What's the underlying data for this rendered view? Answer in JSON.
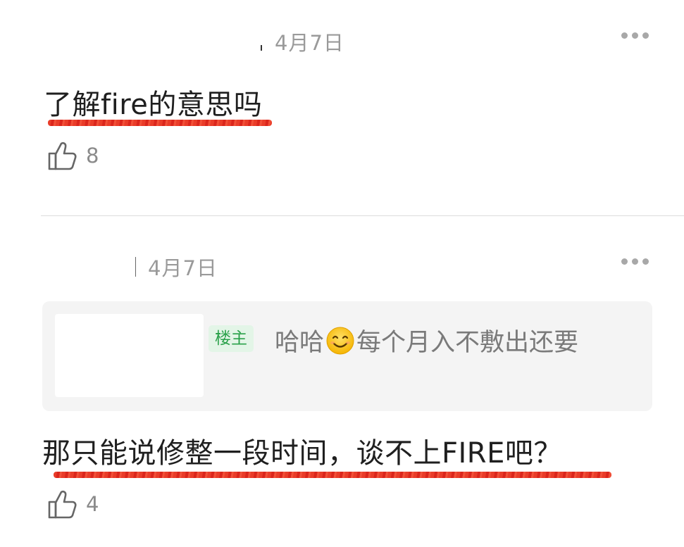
{
  "comments": [
    {
      "date": "4月7日",
      "text": "了解fire的意思吗",
      "like_count": "8"
    },
    {
      "date": "4月7日",
      "quote": {
        "badge": "楼主",
        "text_before": "哈哈",
        "emoji": "smiling-face-icon",
        "text_after": "每个月入不敷出还要"
      },
      "text": "那只能说修整一段时间，谈不上FIRE吧？",
      "like_count": "4"
    }
  ],
  "colors": {
    "underline": "#e8321e",
    "badge_bg": "#e3f5e7",
    "badge_text": "#2aa14a",
    "muted": "#9a9a9a"
  }
}
